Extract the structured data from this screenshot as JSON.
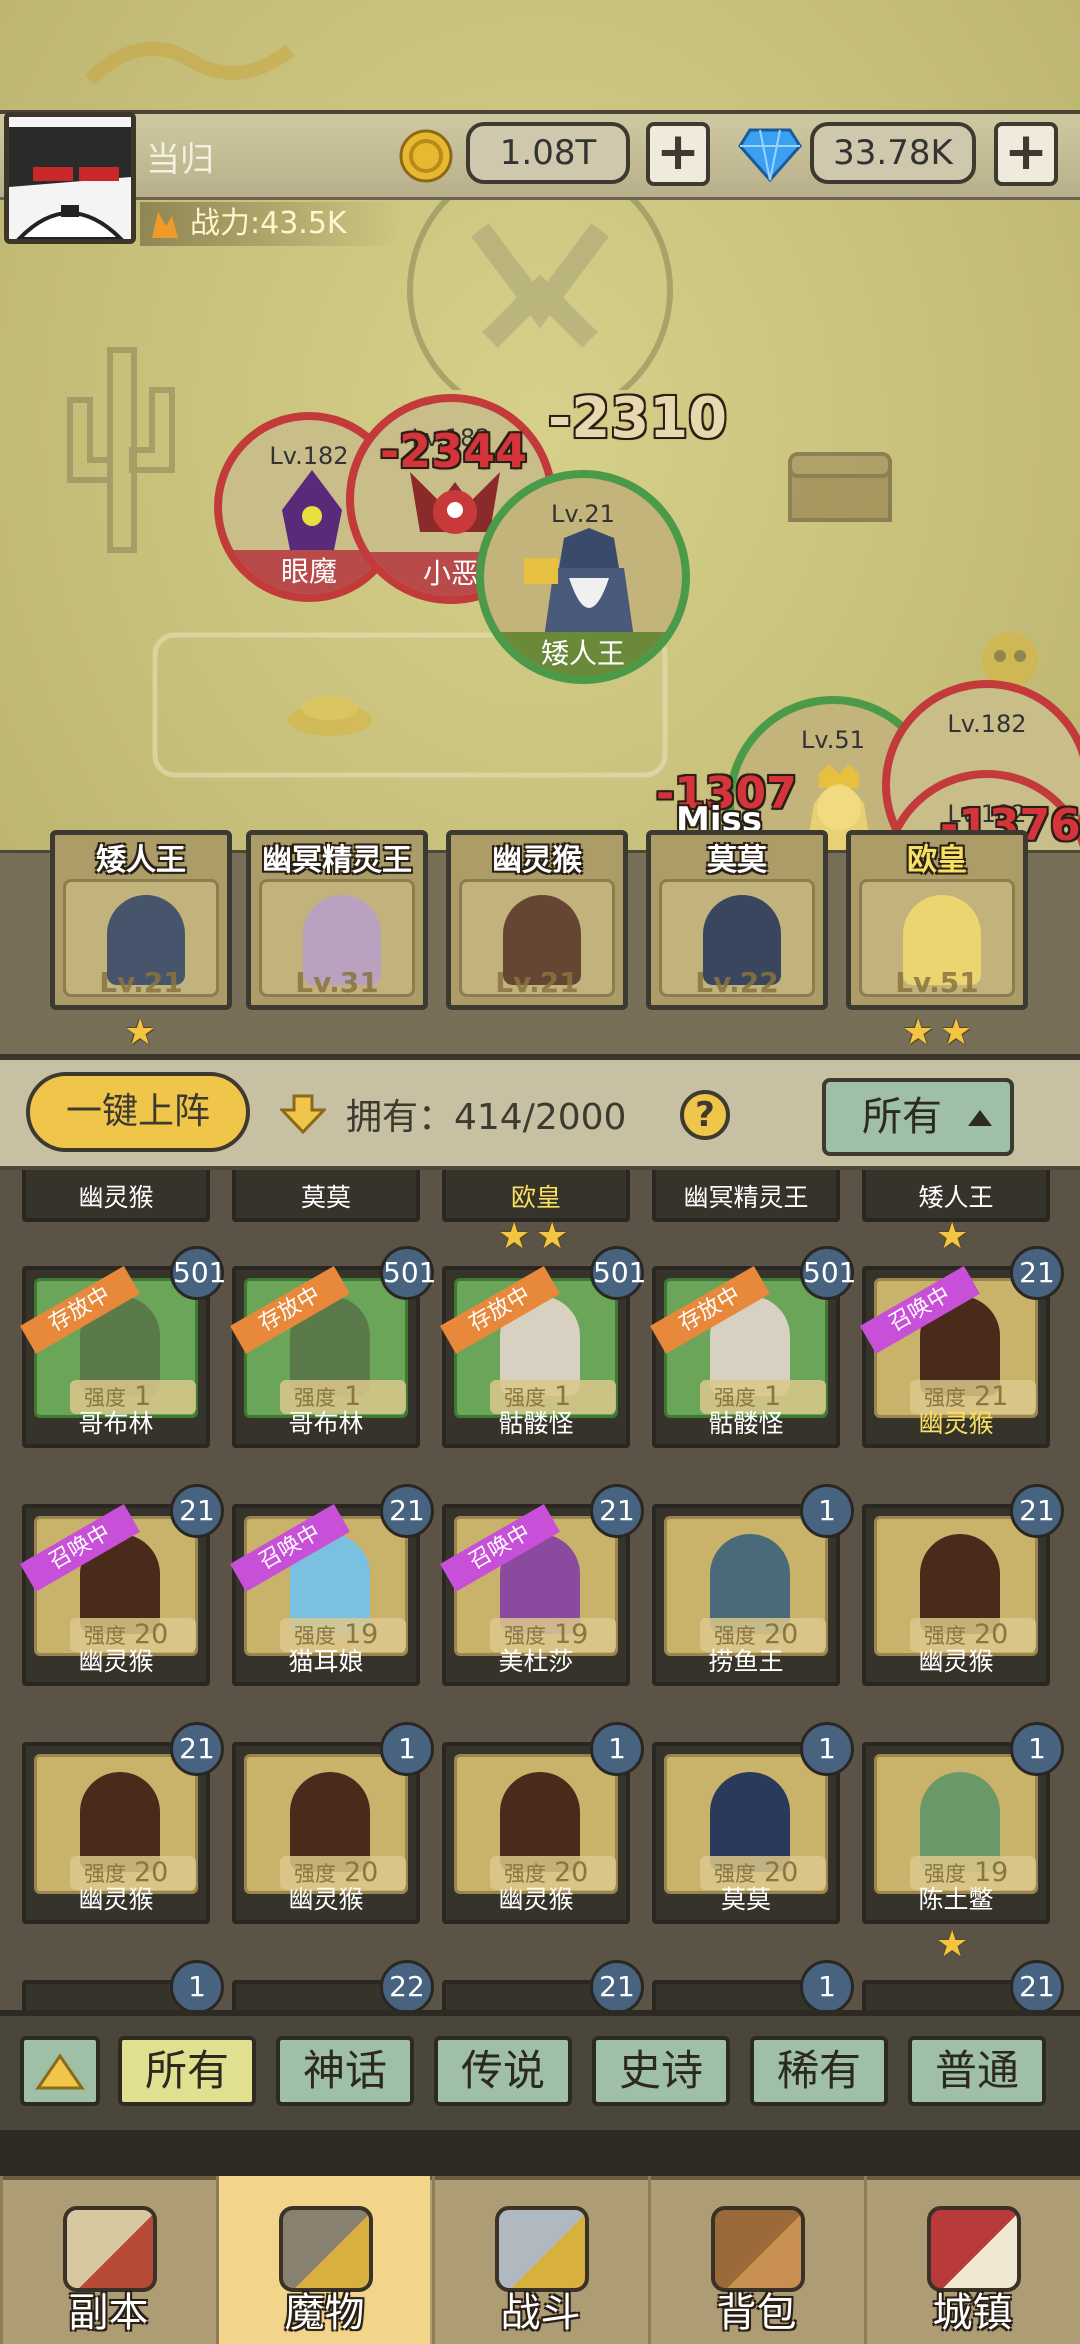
{
  "player": {
    "name": "当归",
    "power": "战力:43.5K",
    "gold": "1.08T",
    "gems": "33.78K",
    "plus": "+"
  },
  "battle": {
    "units": [
      {
        "lv": "Lv.182",
        "name": "眼魔"
      },
      {
        "lv": "Lv.182",
        "name": "小恶"
      },
      {
        "lv": "Lv.21",
        "name": "矮人王"
      },
      {
        "lv": "Lv.51",
        "name": ""
      },
      {
        "lv": "Lv.182",
        "name": ""
      },
      {
        "lv": "Lv.182",
        "name": ""
      }
    ],
    "damage": [
      "-2310",
      "-2344",
      "-1307",
      "Miss",
      "-1376"
    ]
  },
  "team": [
    {
      "name": "矮人王",
      "lv": "Lv.21",
      "stars": 1
    },
    {
      "name": "幽冥精灵王",
      "lv": "Lv.31",
      "stars": 0
    },
    {
      "name": "幽灵猴",
      "lv": "Lv.21",
      "stars": 0
    },
    {
      "name": "莫莫",
      "lv": "Lv.22",
      "stars": 0
    },
    {
      "name": "欧皇",
      "lv": "Lv.51",
      "stars": 2
    }
  ],
  "controls": {
    "one_click": "一键上阵",
    "owned": "拥有：414/2000",
    "help": "?",
    "filter": "所有"
  },
  "partial_row": [
    {
      "name": "幽灵猴",
      "stars": 0
    },
    {
      "name": "莫莫",
      "stars": 0
    },
    {
      "name": "欧皇",
      "stars": 2
    },
    {
      "name": "幽冥精灵王",
      "stars": 0
    },
    {
      "name": "矮人王",
      "stars": 1
    }
  ],
  "monsters": [
    {
      "name": "哥布林",
      "count": "501",
      "tag": "存放中",
      "str": "1",
      "bg": "#6aa55a",
      "stars": 0
    },
    {
      "name": "哥布林",
      "count": "501",
      "tag": "存放中",
      "str": "1",
      "bg": "#6aa55a",
      "stars": 0
    },
    {
      "name": "骷髅怪",
      "count": "501",
      "tag": "存放中",
      "str": "1",
      "bg": "#6aa55a",
      "stars": 0
    },
    {
      "name": "骷髅怪",
      "count": "501",
      "tag": "存放中",
      "str": "1",
      "bg": "#6aa55a",
      "stars": 0
    },
    {
      "name": "幽灵猴",
      "count": "21",
      "tag": "召唤中",
      "str": "21",
      "bg": "#c9b36b",
      "stars": 0
    },
    {
      "name": "幽灵猴",
      "count": "21",
      "tag": "召唤中",
      "str": "20",
      "bg": "#c9b36b",
      "stars": 0
    },
    {
      "name": "猫耳娘",
      "count": "21",
      "tag": "召唤中",
      "str": "19",
      "bg": "#c9b36b",
      "stars": 0
    },
    {
      "name": "美杜莎",
      "count": "21",
      "tag": "召唤中",
      "str": "19",
      "bg": "#c9b36b",
      "stars": 0
    },
    {
      "name": "捞鱼王",
      "count": "1",
      "tag": "",
      "str": "20",
      "bg": "#c9b36b",
      "stars": 0
    },
    {
      "name": "幽灵猴",
      "count": "21",
      "tag": "",
      "str": "20",
      "bg": "#c9b36b",
      "stars": 0
    },
    {
      "name": "幽灵猴",
      "count": "21",
      "tag": "",
      "str": "20",
      "bg": "#c9b36b",
      "stars": 0
    },
    {
      "name": "幽灵猴",
      "count": "1",
      "tag": "",
      "str": "20",
      "bg": "#c9b36b",
      "stars": 0
    },
    {
      "name": "幽灵猴",
      "count": "1",
      "tag": "",
      "str": "20",
      "bg": "#c9b36b",
      "stars": 0
    },
    {
      "name": "莫莫",
      "count": "1",
      "tag": "",
      "str": "20",
      "bg": "#c9b36b",
      "stars": 0
    },
    {
      "name": "陈土鳖",
      "count": "1",
      "tag": "",
      "str": "19",
      "bg": "#c9b36b",
      "stars": 1
    }
  ],
  "next_row_counts": [
    "1",
    "22",
    "21",
    "1",
    "21"
  ],
  "strength_label": "强度",
  "rarity_tabs": [
    "所有",
    "神话",
    "传说",
    "史诗",
    "稀有",
    "普通"
  ],
  "nav": [
    {
      "label": "副本",
      "icon": "map-compass-icon"
    },
    {
      "label": "魔物",
      "icon": "helmet-icon"
    },
    {
      "label": "战斗",
      "icon": "crossed-swords-icon"
    },
    {
      "label": "背包",
      "icon": "backpack-icon"
    },
    {
      "label": "城镇",
      "icon": "shop-icon"
    }
  ],
  "colors": {
    "gold": "#f0c64a",
    "store_tag": "#e8883a",
    "summon_tag": "#c84fd8",
    "mint": "#9fbfa6",
    "nav_active": "#f2d58a"
  }
}
